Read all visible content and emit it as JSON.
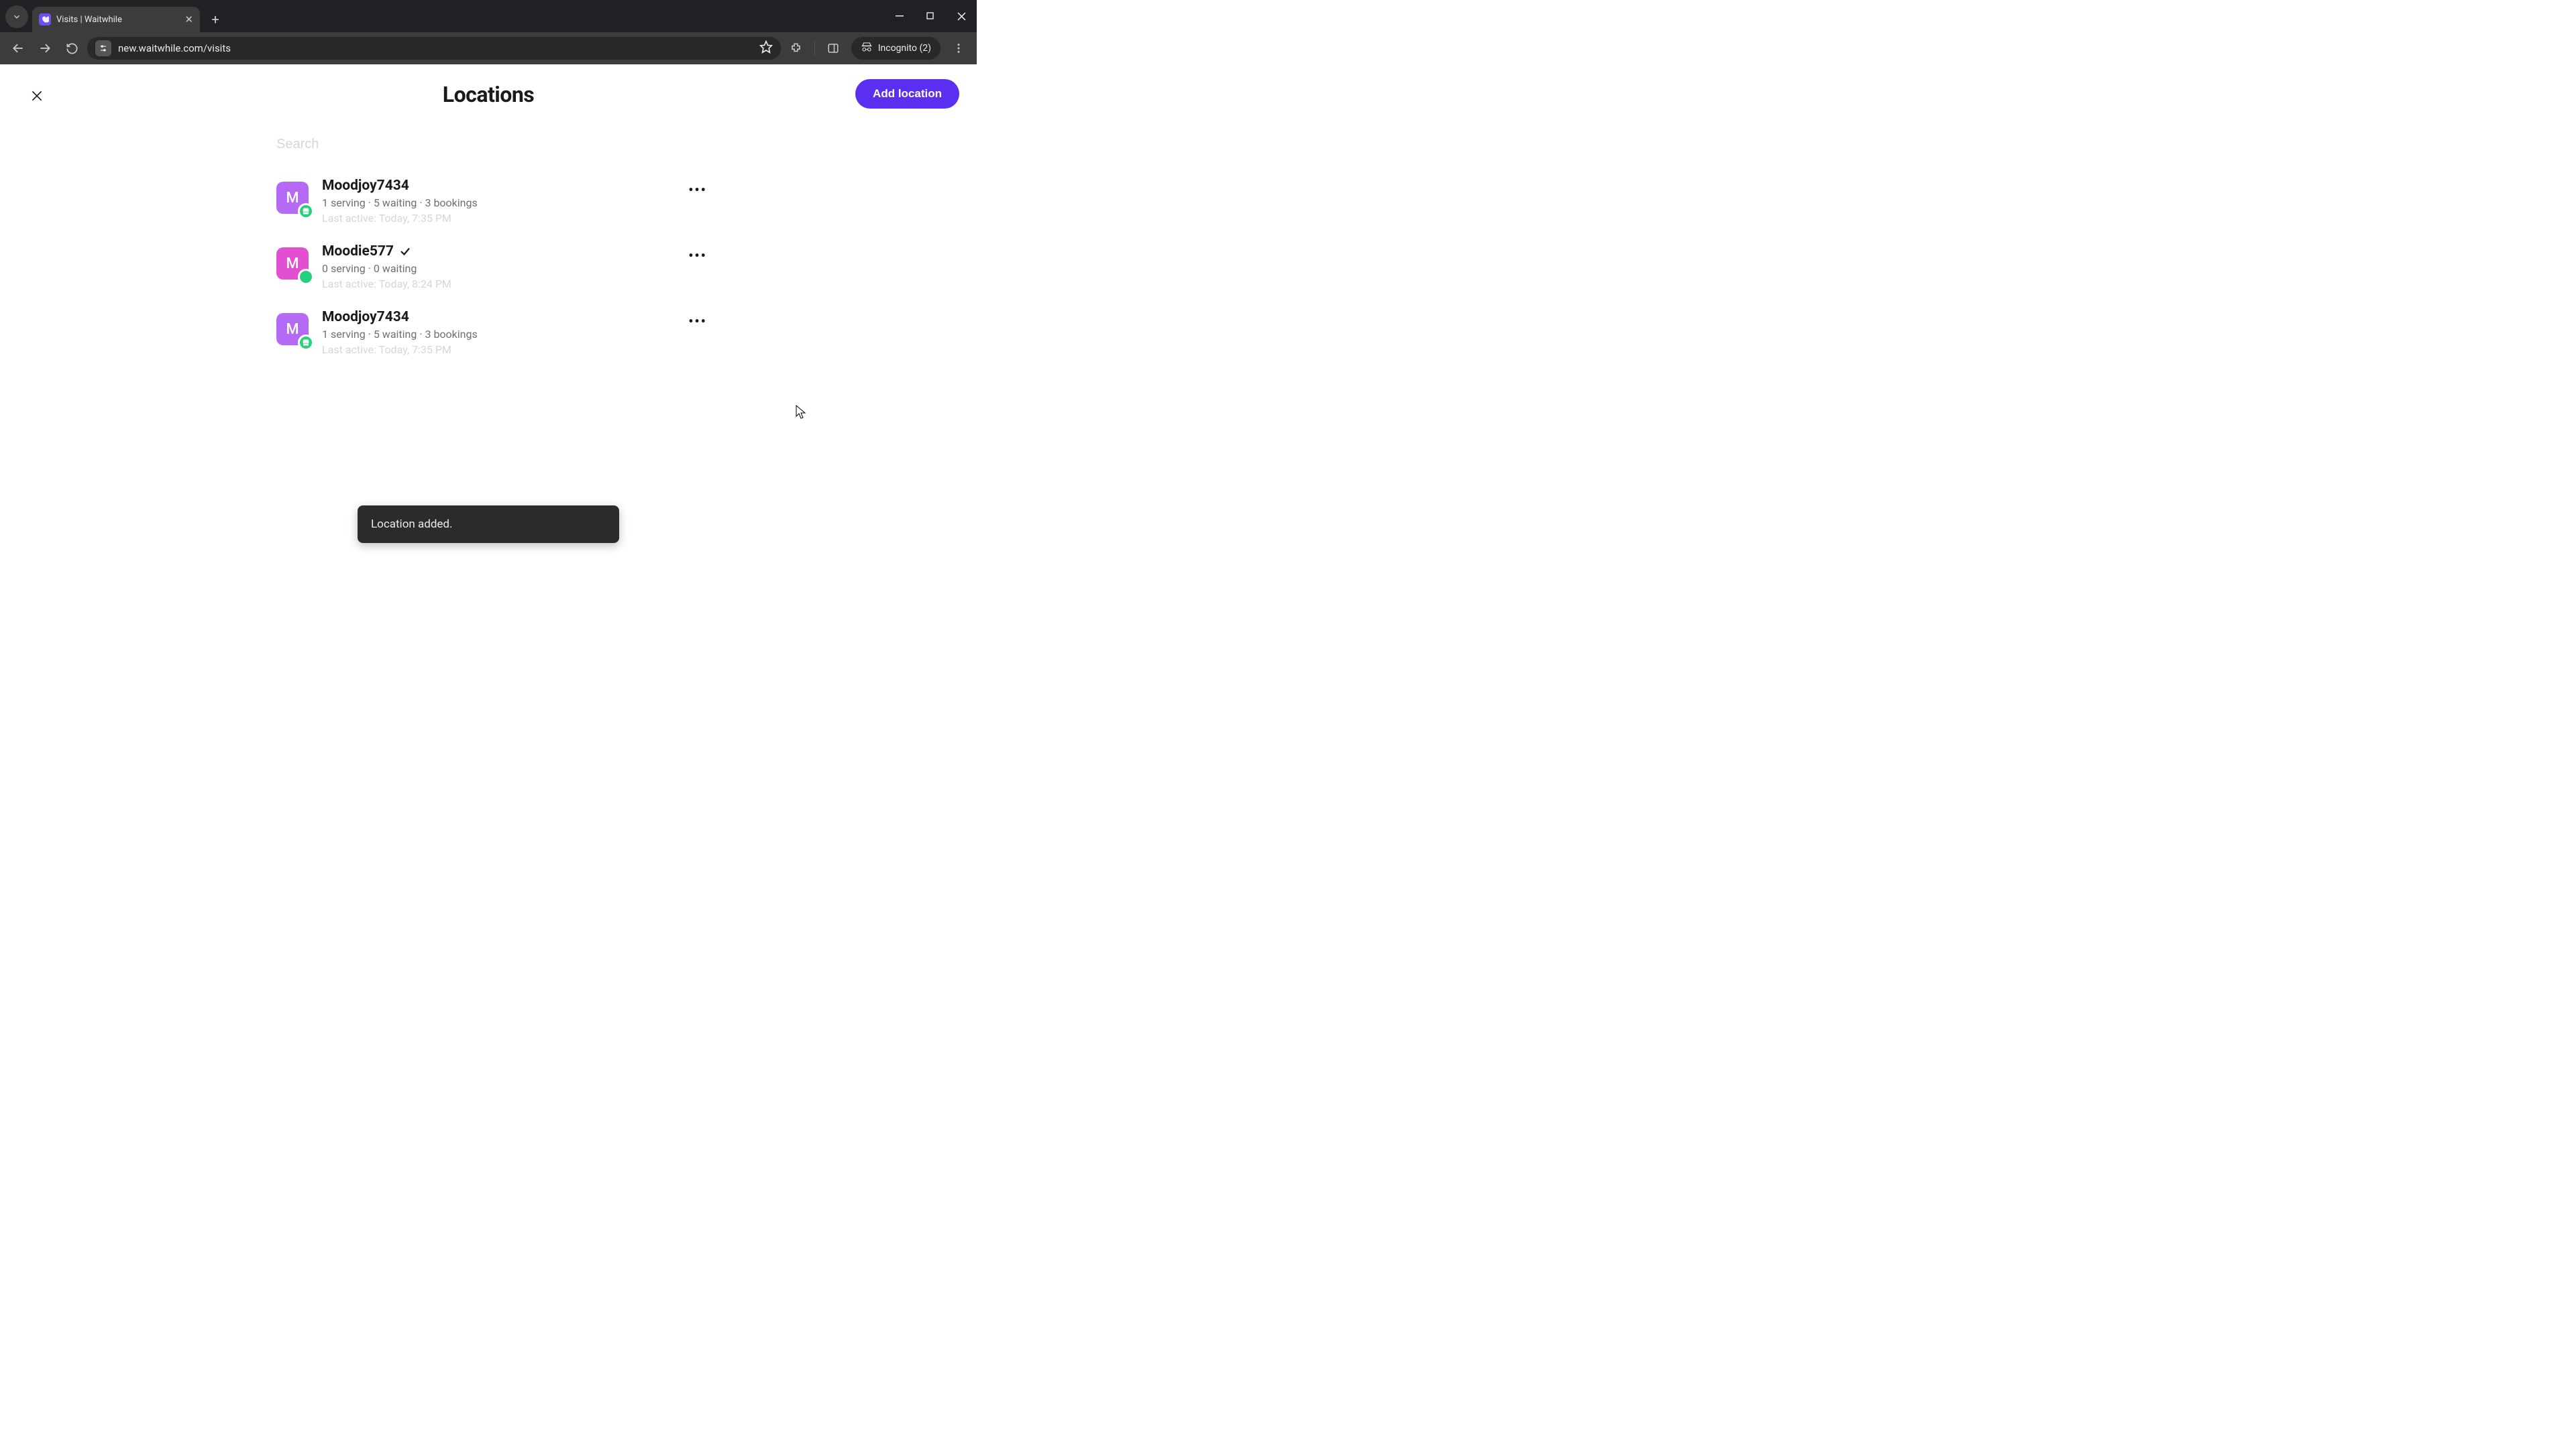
{
  "browser": {
    "tab_title": "Visits | Waitwhile",
    "url": "new.waitwhile.com/visits",
    "incognito_label": "Incognito (2)"
  },
  "header": {
    "title": "Locations",
    "add_button": "Add location"
  },
  "search": {
    "placeholder": "Search"
  },
  "locations": [
    {
      "initial": "M",
      "avatar_class": "av-purple",
      "badge_type": "store",
      "name": "Moodjoy7434",
      "selected": false,
      "stats": "1 serving · 5 waiting · 3 bookings",
      "last_active": "Last active: Today, 7:35 PM"
    },
    {
      "initial": "M",
      "avatar_class": "av-pink",
      "badge_type": "dot",
      "name": "Moodie577",
      "selected": true,
      "stats": "0 serving · 0 waiting",
      "last_active": "Last active: Today, 8:24 PM"
    },
    {
      "initial": "M",
      "avatar_class": "av-purple",
      "badge_type": "store",
      "name": "Moodjoy7434",
      "selected": false,
      "stats": "1 serving · 5 waiting · 3 bookings",
      "last_active": "Last active: Today, 7:35 PM"
    }
  ],
  "toast": {
    "message": "Location added."
  }
}
